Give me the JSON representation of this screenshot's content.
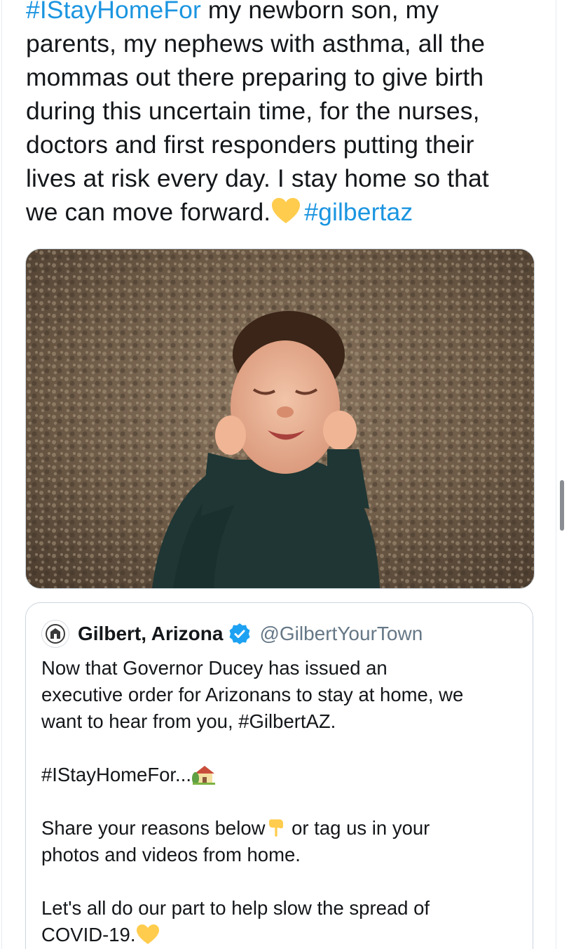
{
  "tweet": {
    "hashtag_open": "#IStayHomeFor",
    "line1_rest": " my newborn son, my",
    "line2": "parents, my nephews with asthma, all the",
    "line3": "mommas out there preparing to give birth",
    "line4": "during this uncertain time, for the nurses,",
    "line5": "doctors and first responders putting their",
    "line6": "lives at risk every day. I stay home so that",
    "line7_start": "we can move forward.",
    "emoji_after_line7": "yellow-heart-icon",
    "hashtag_close": "#gilbertaz",
    "media_alt_subject": "newborn baby on shag rug"
  },
  "quote": {
    "name": "Gilbert, Arizona",
    "handle": "@GilbertYourTown",
    "verified_icon": "verified-badge-icon",
    "avatar_icon": "town-seal-avatar-icon",
    "p1_line1": "Now that Governor Ducey has issued an",
    "p1_line2": "executive order for Arizonans to stay at home, we",
    "p1_line3": "want to hear from you, #GilbertAZ.",
    "p2": "#IStayHomeFor...",
    "p2_emoji": "house-with-garden-icon",
    "p3_line1_start": "Share your reasons below",
    "p3_emoji": "pointing-down-icon",
    "p3_line1_end": " or tag us in your",
    "p3_line2": "photos and videos from home.",
    "p4_line1": "Let's all do our part to help slow the spread of",
    "p4_line2": "COVID-19.",
    "p4_emoji": "yellow-heart-icon"
  },
  "colors": {
    "link": "#1b95e0",
    "text": "#14171a",
    "secondary": "#657786",
    "border": "#ccd6dd",
    "verified": "#1da1f2",
    "heart": "#ffcc4d"
  }
}
